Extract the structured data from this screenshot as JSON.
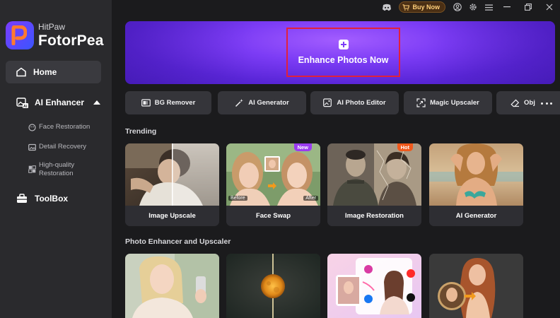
{
  "app": {
    "brand_small": "HitPaw",
    "brand_big": "FotorPea"
  },
  "titlebar": {
    "buy_label": "Buy Now",
    "icons": [
      "discord-icon",
      "cart-icon",
      "account-icon",
      "settings-icon",
      "menu-icon",
      "minimize-icon",
      "restore-icon",
      "close-icon"
    ]
  },
  "sidebar": {
    "home": "Home",
    "ai_enhancer": "AI Enhancer",
    "sub_items": [
      "Face Restoration",
      "Detail Recovery",
      "High-quality\nRestoration"
    ],
    "toolbox": "ToolBox"
  },
  "banner": {
    "label": "Enhance Photos Now"
  },
  "tools": [
    "BG Remover",
    "AI Generator",
    "AI Photo Editor",
    "Magic Upscaler",
    "Obj"
  ],
  "trending": {
    "title": "Trending",
    "cards": [
      {
        "label": "Image Upscale"
      },
      {
        "label": "Face Swap",
        "badge": "New",
        "before": "Before",
        "after": "After"
      },
      {
        "label": "Image Restoration",
        "badge": "Hot"
      },
      {
        "label": "AI Generator"
      }
    ]
  },
  "enhancer_section": {
    "title": "Photo Enhancer and Upscaler"
  },
  "colors": {
    "accent": "#7c3cf5",
    "new_badge": "#9b3cf0",
    "hot_badge": "#f0591c",
    "highlight_border": "#e0213c"
  }
}
